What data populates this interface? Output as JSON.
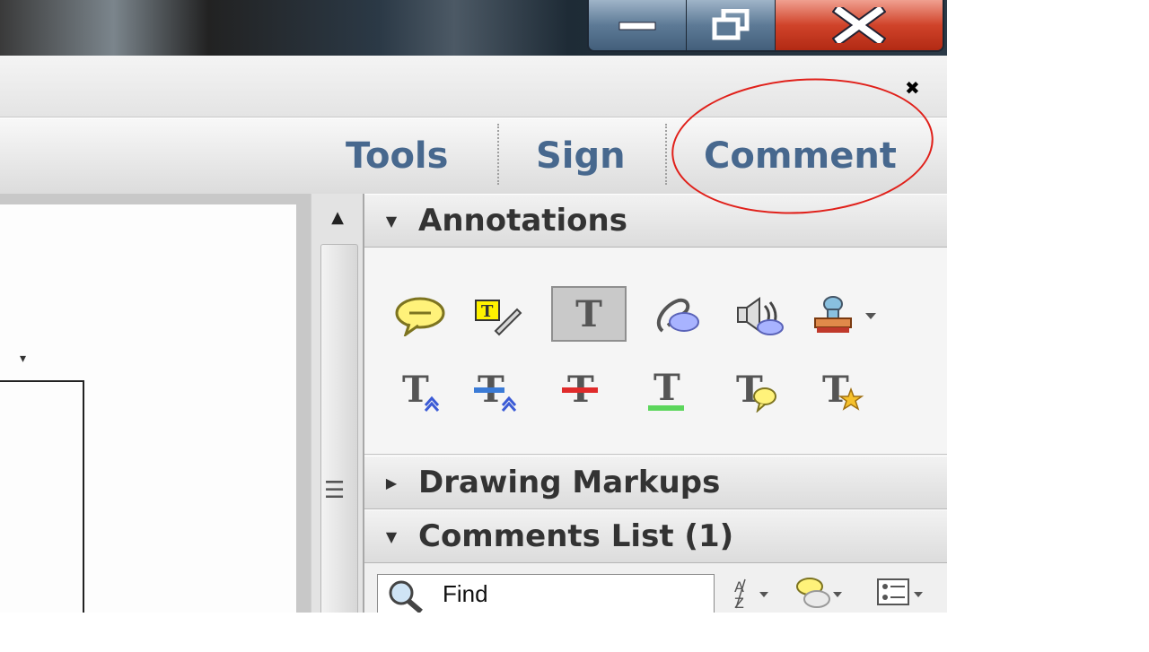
{
  "window": {
    "buttons": {
      "minimize": "minimize",
      "maximize": "restore",
      "close": "close"
    }
  },
  "toolbar": {
    "hide_icon": "close-x-icon"
  },
  "tabs": [
    {
      "label": "Tools"
    },
    {
      "label": "Sign"
    },
    {
      "label": "Comment"
    }
  ],
  "panel": {
    "annotations_label": "Annotations",
    "drawing_markups_label": "Drawing Markups",
    "comments_list_label": "Comments List (1)",
    "annotation_tools": [
      "sticky-note-icon",
      "highlight-text-icon",
      "add-text-comment-icon",
      "attach-file-icon",
      "record-audio-icon",
      "add-stamp-icon",
      "insert-text-icon",
      "replace-text-icon",
      "strikethrough-icon",
      "underline-text-icon",
      "add-note-to-text-icon",
      "add-text-callout-icon"
    ],
    "selected_tool_glyph": "T",
    "search": {
      "placeholder": "Find"
    }
  },
  "annotation_overlay": {
    "color": "#e0201a",
    "target": "Comment"
  }
}
